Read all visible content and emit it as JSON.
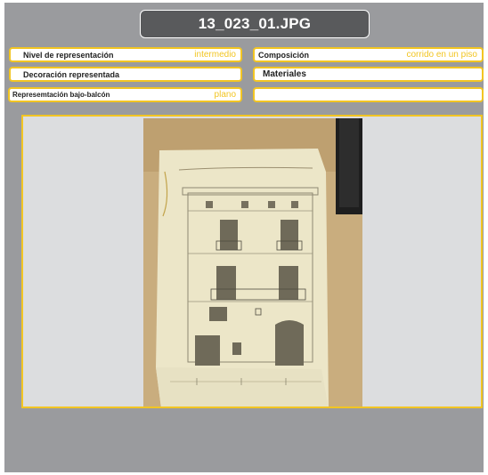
{
  "title": "13_023_01.JPG",
  "fields": {
    "nivel": {
      "label": "Nivel de representación",
      "value": "intermedio"
    },
    "composicion": {
      "label": "Composición",
      "value": "corrido en un piso"
    },
    "decoracion": {
      "label": "Decoración representada",
      "value": ""
    },
    "materiales": {
      "label": "Materiales",
      "value": ""
    },
    "bajo_balcon": {
      "label": "Represemtación bajo-balcón",
      "value": "plano"
    },
    "empty": {
      "label": "",
      "value": ""
    }
  },
  "colors": {
    "accent": "#f2c522",
    "frame": "#9a9b9e",
    "title_bg": "#595a5c",
    "panel": "#dcdddf"
  },
  "image": {
    "description_icon": "facade-drawing-photo"
  }
}
